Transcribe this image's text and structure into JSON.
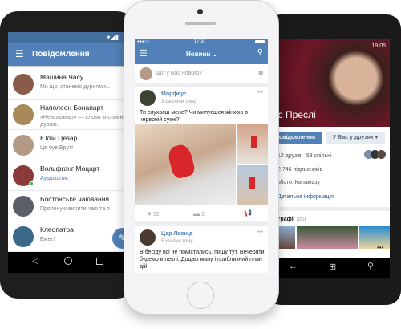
{
  "left_phone": {
    "header_title": "Повідомлення",
    "conversations": [
      {
        "name": "Машина Часу",
        "message": "Ми що, станемо дурнями..."
      },
      {
        "name": "Наполеон Бонапарт",
        "message": "«Неможливо» — слово зі словника",
        "message2": "дурнів."
      },
      {
        "name": "Юлій Цезар",
        "message": "Це був Брут!"
      },
      {
        "name": "Вольфганг Моцарт",
        "message": "Аудіозапис"
      },
      {
        "name": "Бостонське чаювання",
        "message": "Пропоную випити чаю та п"
      },
      {
        "name": "Клеопатра",
        "message": "Емет!"
      }
    ]
  },
  "middle_phone": {
    "time": "17:37",
    "header_title": "Новини",
    "composer_placeholder": "Що у Вас нового?",
    "posts": [
      {
        "author": "Морфеус",
        "time": "3 хвилини тому",
        "text": "Ти слухаєш мене? Чи милуєшся жінкою в червоній сукні?",
        "likes": "32",
        "comments": "2"
      },
      {
        "author": "Цар Леонід",
        "time": "5 хвилин тому",
        "text": "В бесіду всі не помістились, пишу тут. Вечеряти будемо в пеклі. Додаю мапу і приблизний план дій."
      }
    ]
  },
  "right_phone": {
    "time": "19:05",
    "profile_name": "іс Преслі",
    "message_button": "овідомлення",
    "friends_button": "У Вас у друзях",
    "friends_line": "12 друзів · 53 спільні",
    "followers": "2 746 підписників",
    "city": "Місто: Каламазу",
    "details_link": "Детальна інформація",
    "photos_label": "трафії",
    "photos_count": "350"
  },
  "colors": {
    "accent": "#5181b8",
    "link": "#2a5885"
  }
}
